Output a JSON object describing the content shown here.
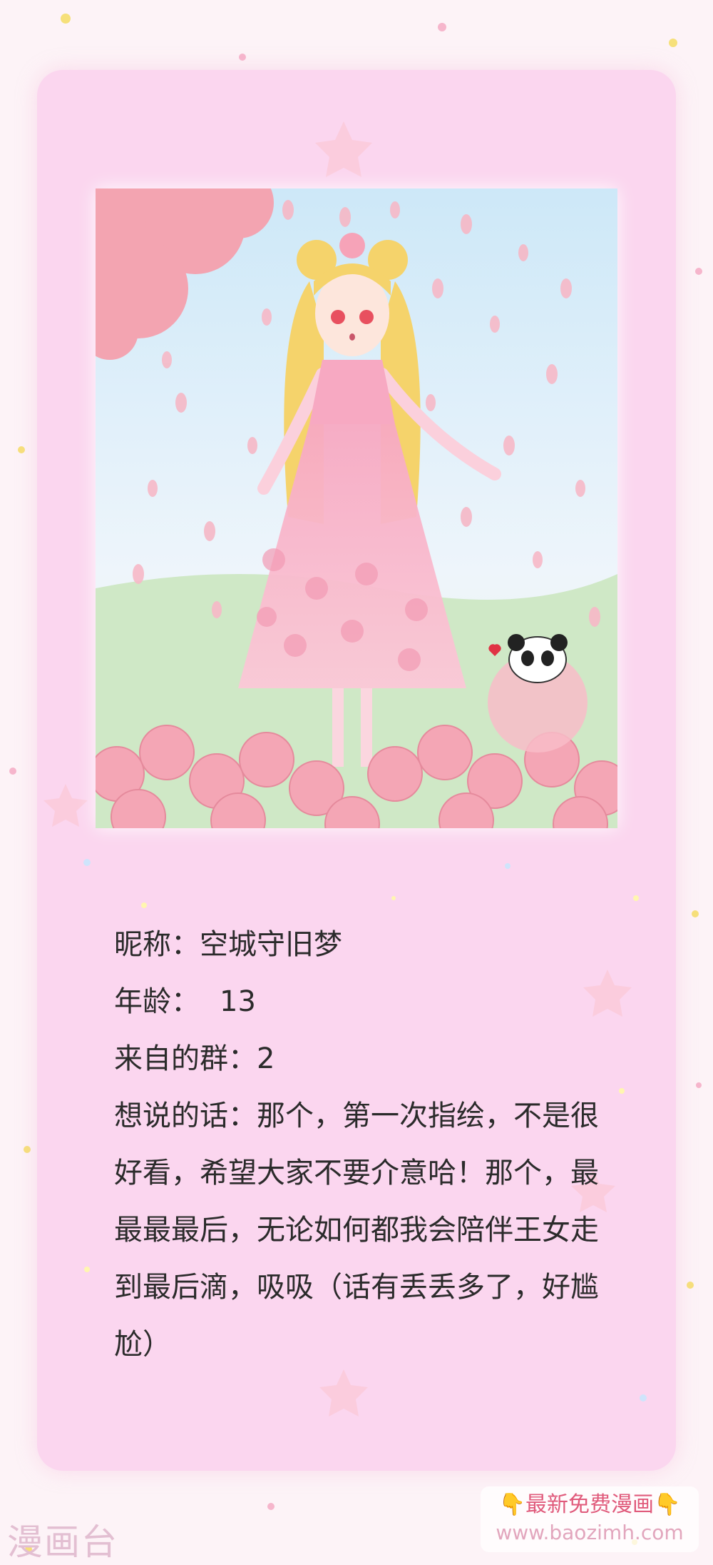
{
  "profile": {
    "nickname_label": "昵称：",
    "nickname": "空城守旧梦",
    "age_label": "年龄：",
    "age": "13",
    "group_label": "来自的群：",
    "group": "2",
    "message_label": "想说的话：",
    "message": "那个，第一次指绘，不是很好看，希望大家不要介意哈！那个，最最最最后，无论如何都我会陪伴王女走到最后滴，吸吸（话有丢丢多了，好尴尬）"
  },
  "watermark": {
    "site_name": "漫画台"
  },
  "promo": {
    "title": "最新免费漫画",
    "url": "www.baozimh.com",
    "icon": "pointing-down-icon"
  },
  "colors": {
    "card": "#fbd6ef",
    "background": "#fdf3f7",
    "text": "#2b2b2b"
  }
}
